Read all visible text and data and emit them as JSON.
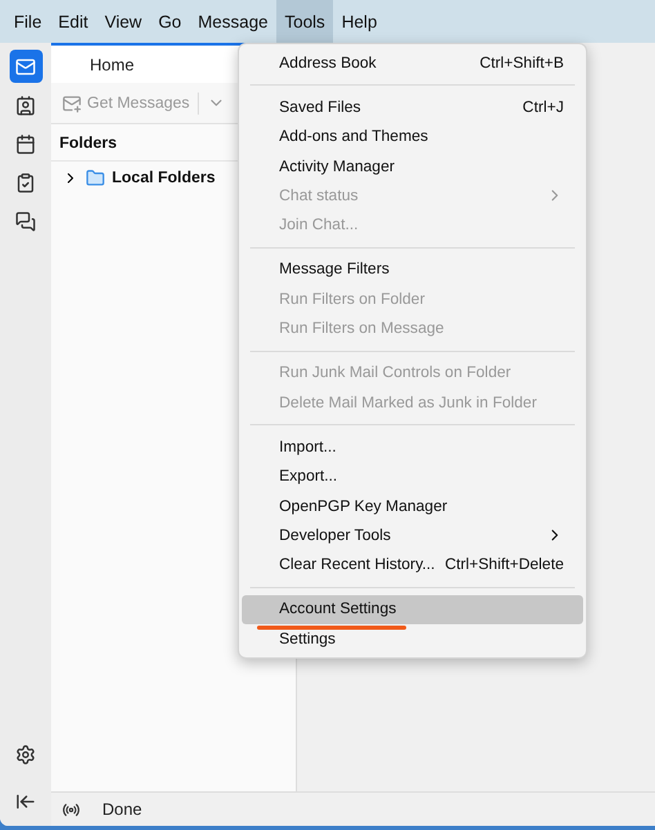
{
  "menubar": [
    {
      "label": "File",
      "selected": false
    },
    {
      "label": "Edit",
      "selected": false
    },
    {
      "label": "View",
      "selected": false
    },
    {
      "label": "Go",
      "selected": false
    },
    {
      "label": "Message",
      "selected": false
    },
    {
      "label": "Tools",
      "selected": true
    },
    {
      "label": "Help",
      "selected": false
    }
  ],
  "spaces": [
    {
      "kind": "mail",
      "selected": true
    },
    {
      "kind": "contacts",
      "selected": false
    },
    {
      "kind": "calendar",
      "selected": false
    },
    {
      "kind": "tasks",
      "selected": false
    },
    {
      "kind": "chat",
      "selected": false
    }
  ],
  "tab": {
    "label": "Home"
  },
  "toolbar": {
    "get_messages": "Get Messages"
  },
  "folders": {
    "title": "Folders",
    "items": [
      {
        "label": "Local Folders",
        "expanded": false
      }
    ]
  },
  "status_bar": {
    "text": "Done"
  },
  "tools_menu": [
    {
      "kind": "item",
      "label": "Address Book",
      "shortcut": "Ctrl+Shift+B",
      "disabled": false,
      "submenu": false,
      "selected": false
    },
    {
      "kind": "separator"
    },
    {
      "kind": "item",
      "label": "Saved Files",
      "shortcut": "Ctrl+J",
      "disabled": false,
      "submenu": false,
      "selected": false
    },
    {
      "kind": "item",
      "label": "Add-ons and Themes",
      "disabled": false,
      "submenu": false,
      "selected": false
    },
    {
      "kind": "item",
      "label": "Activity Manager",
      "disabled": false,
      "submenu": false,
      "selected": false
    },
    {
      "kind": "item",
      "label": "Chat status",
      "disabled": true,
      "submenu": true,
      "selected": false
    },
    {
      "kind": "item",
      "label": "Join Chat...",
      "disabled": true,
      "submenu": false,
      "selected": false
    },
    {
      "kind": "separator"
    },
    {
      "kind": "item",
      "label": "Message Filters",
      "disabled": false,
      "submenu": false,
      "selected": false
    },
    {
      "kind": "item",
      "label": "Run Filters on Folder",
      "disabled": true,
      "submenu": false,
      "selected": false
    },
    {
      "kind": "item",
      "label": "Run Filters on Message",
      "disabled": true,
      "submenu": false,
      "selected": false
    },
    {
      "kind": "separator"
    },
    {
      "kind": "item",
      "label": "Run Junk Mail Controls on Folder",
      "disabled": true,
      "submenu": false,
      "selected": false
    },
    {
      "kind": "item",
      "label": "Delete Mail Marked as Junk in Folder",
      "disabled": true,
      "submenu": false,
      "selected": false
    },
    {
      "kind": "separator"
    },
    {
      "kind": "item",
      "label": "Import...",
      "disabled": false,
      "submenu": false,
      "selected": false
    },
    {
      "kind": "item",
      "label": "Export...",
      "disabled": false,
      "submenu": false,
      "selected": false
    },
    {
      "kind": "item",
      "label": "OpenPGP Key Manager",
      "disabled": false,
      "submenu": false,
      "selected": false
    },
    {
      "kind": "item",
      "label": "Developer Tools",
      "disabled": false,
      "submenu": true,
      "selected": false
    },
    {
      "kind": "item",
      "label": "Clear Recent History...",
      "shortcut": "Ctrl+Shift+Delete",
      "disabled": false,
      "submenu": false,
      "selected": false
    },
    {
      "kind": "separator"
    },
    {
      "kind": "item",
      "label": "Account Settings",
      "disabled": false,
      "submenu": false,
      "selected": true,
      "annotated": true
    },
    {
      "kind": "item",
      "label": "Settings",
      "disabled": false,
      "submenu": false,
      "selected": false
    }
  ]
}
